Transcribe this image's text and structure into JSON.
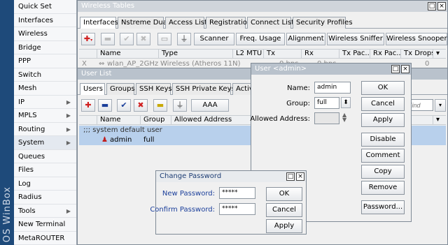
{
  "brand": "OS WinBox",
  "sidebar": {
    "items": [
      {
        "label": "Quick Set",
        "arrow": false
      },
      {
        "label": "Interfaces",
        "arrow": false
      },
      {
        "label": "Wireless",
        "arrow": false
      },
      {
        "label": "Bridge",
        "arrow": false
      },
      {
        "label": "PPP",
        "arrow": false
      },
      {
        "label": "Switch",
        "arrow": false
      },
      {
        "label": "Mesh",
        "arrow": false
      },
      {
        "label": "IP",
        "arrow": true
      },
      {
        "label": "MPLS",
        "arrow": true
      },
      {
        "label": "Routing",
        "arrow": true
      },
      {
        "label": "System",
        "arrow": true
      },
      {
        "label": "Queues",
        "arrow": false
      },
      {
        "label": "Files",
        "arrow": false
      },
      {
        "label": "Log",
        "arrow": false
      },
      {
        "label": "Radius",
        "arrow": false
      },
      {
        "label": "Tools",
        "arrow": true
      },
      {
        "label": "New Terminal",
        "arrow": false
      },
      {
        "label": "MetaROUTER",
        "arrow": false
      }
    ],
    "arrow_glyph": "▶"
  },
  "wireless": {
    "title": "Wireless Tables",
    "tabs": [
      "Interfaces",
      "Nstreme Dual",
      "Access List",
      "Registration",
      "Connect List",
      "Security Profiles"
    ],
    "buttons": [
      "Scanner",
      "Freq. Usage",
      "Alignment",
      "Wireless Sniffer",
      "Wireless Snooper"
    ],
    "columns": [
      "Name",
      "Type",
      "L2 MTU",
      "Tx",
      "Rx",
      "Tx Pac...",
      "Rx Pac...",
      "Tx Drops"
    ],
    "row": {
      "flag": "X",
      "name": "wlan_AP_2GHz",
      "type": "Wireless (Atheros 11N)",
      "tx": "0 bps",
      "rx": "0 bps",
      "drops": "0"
    }
  },
  "userlist": {
    "title": "User List",
    "tabs": [
      "Users",
      "Groups",
      "SSH Keys",
      "SSH Private Keys",
      "Active"
    ],
    "aaa_button": "AAA",
    "find_placeholder": "Find",
    "columns": [
      "Name",
      "Group",
      "Allowed Address"
    ],
    "section_label": ";;; system default user",
    "rows": [
      {
        "name": "admin",
        "group": "full",
        "address": ""
      }
    ]
  },
  "user_dialog": {
    "title": "User <admin>",
    "name_label": "Name:",
    "name_value": "admin",
    "group_label": "Group:",
    "group_value": "full",
    "address_label": "Allowed Address:",
    "buttons": [
      "OK",
      "Cancel",
      "Apply",
      "Disable",
      "Comment",
      "Copy",
      "Remove",
      "Password..."
    ]
  },
  "password_dialog": {
    "title": "Change Password",
    "new_label": "New Password:",
    "new_value": "*****",
    "confirm_label": "Confirm Password:",
    "confirm_value": "*****",
    "buttons": [
      "OK",
      "Cancel",
      "Apply"
    ]
  },
  "colors": {
    "accent_blue": "#1a3e9a",
    "selected_row": "#b8d0ec",
    "add_red": "#d02020"
  }
}
